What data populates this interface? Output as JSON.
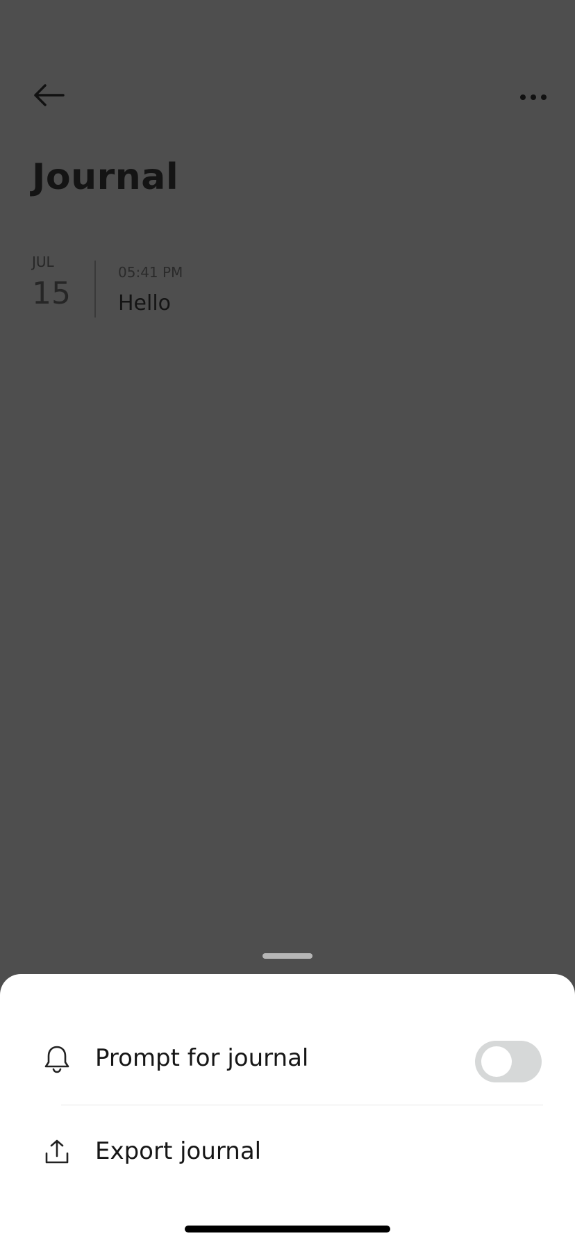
{
  "header": {
    "back_icon": "arrow-left-icon",
    "more_icon": "more-horizontal-icon",
    "title": "Journal"
  },
  "entries": [
    {
      "month": "JUL",
      "day": "15",
      "time": "05:41 PM",
      "text": "Hello"
    }
  ],
  "sheet": {
    "items": [
      {
        "icon": "bell-icon",
        "label": "Prompt for journal",
        "toggle": false
      },
      {
        "icon": "export-icon",
        "label": "Export journal"
      }
    ]
  },
  "colors": {
    "background_dimmed": "#4e4e4e",
    "sheet": "#ffffff",
    "toggle_off": "#d6d8d8"
  }
}
